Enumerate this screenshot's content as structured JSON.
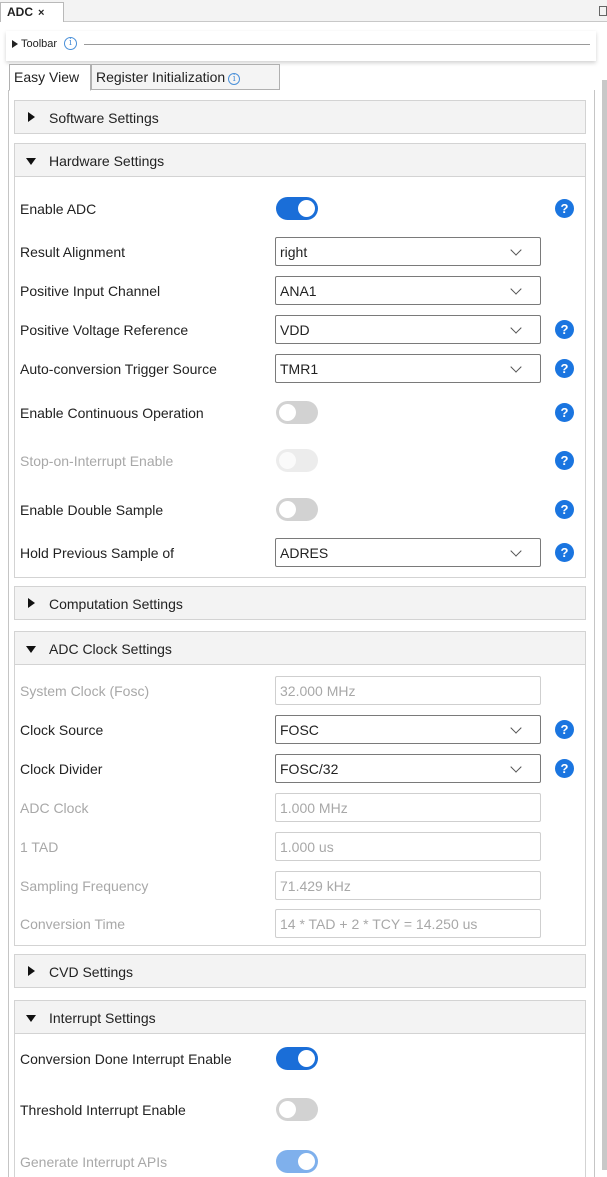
{
  "document_tab": {
    "title": "ADC",
    "close": "×"
  },
  "toolbar": {
    "label": "Toolbar",
    "info": "i"
  },
  "view_tabs": [
    {
      "label": "Easy View"
    },
    {
      "label": "Register Initialization",
      "info": "i"
    }
  ],
  "help_symbol": "?",
  "sections": {
    "software": {
      "label": "Software Settings",
      "expanded": false
    },
    "hardware": {
      "label": "Hardware Settings",
      "expanded": true,
      "rows": [
        {
          "label": "Enable ADC",
          "type": "toggle",
          "state": "on"
        },
        {
          "label": "Result Alignment",
          "type": "select",
          "value": "right"
        },
        {
          "label": "Positive Input Channel",
          "type": "select",
          "value": "ANA1"
        },
        {
          "label": "Positive Voltage Reference",
          "type": "select",
          "value": "VDD"
        },
        {
          "label": "Auto-conversion Trigger Source",
          "type": "select",
          "value": "TMR1"
        },
        {
          "label": "Enable Continuous Operation",
          "type": "toggle",
          "state": "off"
        },
        {
          "label": "Stop-on-Interrupt Enable",
          "type": "toggle",
          "state": "off",
          "disabled": true
        },
        {
          "label": "Enable Double Sample",
          "type": "toggle",
          "state": "off"
        },
        {
          "label": "Hold Previous Sample of",
          "type": "select",
          "value": "ADRES"
        }
      ]
    },
    "computation": {
      "label": "Computation Settings",
      "expanded": false
    },
    "clock": {
      "label": "ADC Clock Settings",
      "expanded": true,
      "rows": [
        {
          "label": "System Clock (Fosc)",
          "type": "readonly",
          "value": "32.000 MHz",
          "disabled": true
        },
        {
          "label": "Clock Source",
          "type": "select",
          "value": "FOSC"
        },
        {
          "label": "Clock Divider",
          "type": "select",
          "value": "FOSC/32"
        },
        {
          "label": "ADC Clock",
          "type": "readonly",
          "value": "1.000 MHz",
          "disabled": true
        },
        {
          "label": "1 TAD",
          "type": "readonly",
          "value": "1.000 us",
          "disabled": true
        },
        {
          "label": "Sampling Frequency",
          "type": "readonly",
          "value": "71.429 kHz",
          "disabled": true
        },
        {
          "label": "Conversion Time",
          "type": "readonly",
          "value": "14 * TAD + 2 * TCY = 14.250 us",
          "disabled": true
        }
      ]
    },
    "cvd": {
      "label": "CVD Settings",
      "expanded": false
    },
    "interrupt": {
      "label": "Interrupt Settings",
      "expanded": true,
      "rows": [
        {
          "label": "Conversion Done Interrupt Enable",
          "type": "toggle",
          "state": "on"
        },
        {
          "label": "Threshold Interrupt Enable",
          "type": "toggle",
          "state": "off"
        },
        {
          "label": "Generate Interrupt APIs",
          "type": "toggle",
          "state": "on",
          "disabled": true
        }
      ]
    }
  },
  "colors": {
    "accent": "#1a6ed8",
    "help": "#1a75e0",
    "disabled_text": "#a8a8a8",
    "section_bg": "#f3f3f3"
  }
}
